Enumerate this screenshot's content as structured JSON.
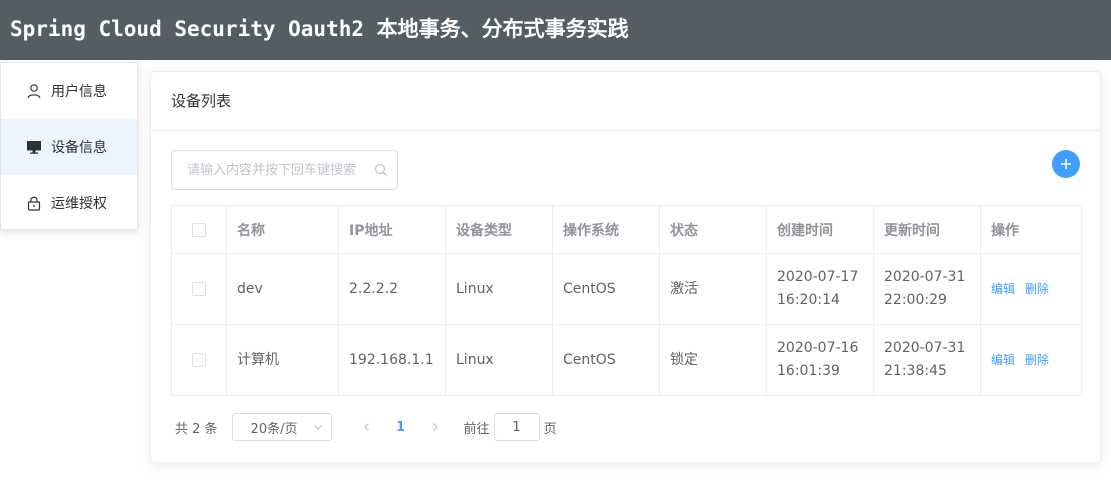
{
  "header": {
    "title": "Spring Cloud Security Oauth2 本地事务、分布式事务实践"
  },
  "sidebar": {
    "items": [
      {
        "label": "用户信息",
        "icon": "user-icon",
        "active": false
      },
      {
        "label": "设备信息",
        "icon": "monitor-icon",
        "active": true
      },
      {
        "label": "运维授权",
        "icon": "lock-icon",
        "active": false
      }
    ]
  },
  "card": {
    "title": "设备列表"
  },
  "search": {
    "placeholder": "请输入内容并按下回车键搜索",
    "value": ""
  },
  "table": {
    "columns": [
      "名称",
      "IP地址",
      "设备类型",
      "操作系统",
      "状态",
      "创建时间",
      "更新时间",
      "操作"
    ],
    "rows": [
      {
        "name": "dev",
        "ip": "2.2.2.2",
        "type": "Linux",
        "os": "CentOS",
        "status": "激活",
        "created_date": "2020-07-17",
        "created_time": "16:20:14",
        "updated_date": "2020-07-31",
        "updated_time": "22:00:29",
        "edit": "编辑",
        "delete": "删除"
      },
      {
        "name": "计算机",
        "ip": "192.168.1.1",
        "type": "Linux",
        "os": "CentOS",
        "status": "锁定",
        "created_date": "2020-07-16",
        "created_time": "16:01:39",
        "updated_date": "2020-07-31",
        "updated_time": "21:38:45",
        "edit": "编辑",
        "delete": "删除"
      }
    ]
  },
  "pagination": {
    "total_label": "共 2 条",
    "page_size_label": "20条/页",
    "current_page": "1",
    "jump_prefix": "前往",
    "jump_value": "1",
    "jump_suffix": "页"
  },
  "colors": {
    "header_bg": "#545c64",
    "accent": "#409eff",
    "active_bg": "#ecf5ff"
  }
}
